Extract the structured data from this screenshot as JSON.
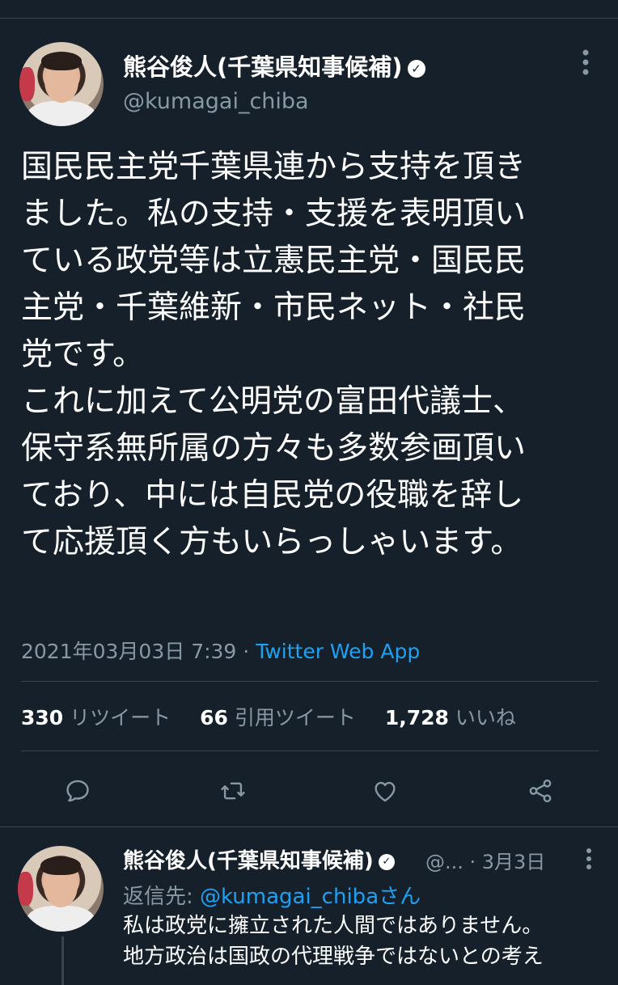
{
  "tweet": {
    "author_name": "熊谷俊人(千葉県知事候補)",
    "author_handle": "@kumagai_chiba",
    "verified_mark": "✓",
    "text_lines": [
      "国民民主党千葉県連から支持を頂き",
      "ました。私の支持・支援を表明頂い",
      "ている政党等は立憲民主党・国民民",
      "主党・千葉維新・市民ネット・社民",
      "党です。",
      "これに加えて公明党の富田代議士、",
      "保守系無所属の方々も多数参画頂い",
      "ており、中には自民党の役職を辞し",
      "て応援頂く方もいらっしゃいます。"
    ],
    "timestamp": "2021年03月03日 7:39 · ",
    "source": "Twitter Web App",
    "stats": {
      "retweets_count": "330",
      "retweets_label": "リツイート",
      "quotes_count": "66",
      "quotes_label": "引用ツイート",
      "likes_count": "1,728",
      "likes_label": "いいね"
    }
  },
  "reply": {
    "author_name": "熊谷俊人(千葉県知事候補)",
    "handle_time": "@... · 3月3日",
    "reply_to_prefix": "返信先: ",
    "reply_to_handle": "@kumagai_chibaさん",
    "text_lines": [
      "私は政党に擁立された人間ではありません。",
      "地方政治は国政の代理戦争ではないとの考え"
    ]
  },
  "colors": {
    "background": "#15202b",
    "text": "#ffffff",
    "secondary": "#8899a6",
    "accent": "#1da1f2",
    "border": "#38444d"
  },
  "icons": [
    "reply-icon",
    "retweet-icon",
    "like-icon",
    "share-icon",
    "more-icon",
    "verified-icon"
  ]
}
